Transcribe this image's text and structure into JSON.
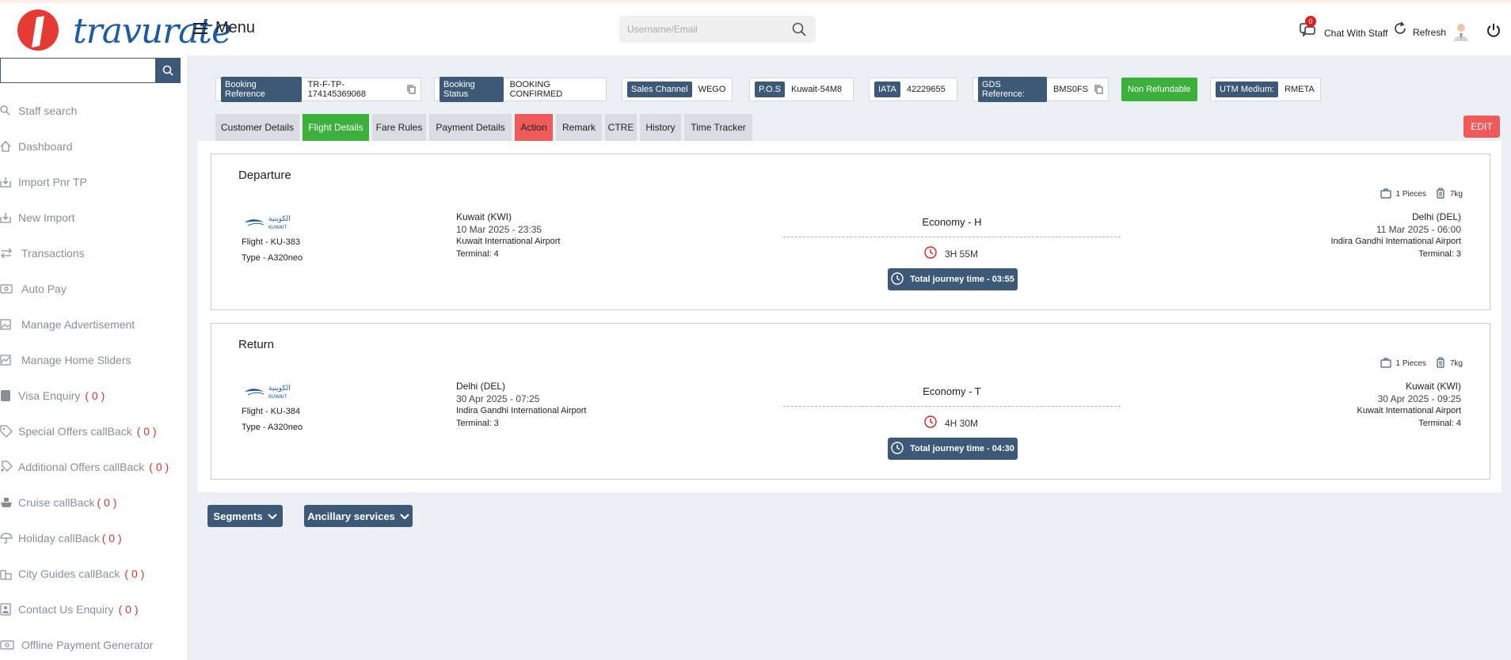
{
  "header": {
    "menu_label": "Menu",
    "search_placeholder": "Username/Email",
    "chat_badge": "0",
    "chat_label": "Chat With Staff",
    "refresh_label": "Refresh"
  },
  "sidebar": {
    "items": [
      {
        "label": "Staff search",
        "icon": "search-icon"
      },
      {
        "label": "Dashboard",
        "icon": "home-icon"
      },
      {
        "label": "Import Pnr TP",
        "icon": "import-icon"
      },
      {
        "label": "New Import",
        "icon": "import-icon"
      },
      {
        "label": "Transactions",
        "icon": "swap-icon"
      },
      {
        "label": "Auto Pay",
        "icon": "money-icon"
      },
      {
        "label": "Manage Advertisement",
        "icon": "image-icon"
      },
      {
        "label": "Manage Home Sliders",
        "icon": "chart-icon"
      },
      {
        "label": "Visa Enquiry",
        "icon": "passport-icon",
        "count": "( 0 )"
      },
      {
        "label": "Special Offers callBack",
        "icon": "tag-icon",
        "count": "( 0 )"
      },
      {
        "label": "Additional Offers callBack",
        "icon": "tag-plus-icon",
        "count": "( 0 )"
      },
      {
        "label": "Cruise callBack",
        "icon": "ship-icon",
        "count": "( 0 )"
      },
      {
        "label": "Holiday callBack",
        "icon": "umbrella-icon",
        "count": "( 0 )"
      },
      {
        "label": "City Guides callBack",
        "icon": "city-icon",
        "count": "( 0 )"
      },
      {
        "label": "Contact Us Enquiry",
        "icon": "contact-icon",
        "count": "( 0 )"
      },
      {
        "label": "Offline Payment Generator",
        "icon": "money-icon"
      }
    ]
  },
  "booking": {
    "reference_tag": "Booking Reference",
    "reference": "TR-F-TP-174145369068",
    "status_tag": "Booking Status",
    "status": "BOOKING CONFIRMED",
    "channel_tag": "Sales Channel",
    "channel": "WEGO",
    "pos_tag": "P.O.S",
    "pos": "Kuwait-54M8",
    "iata_tag": "IATA",
    "iata": "42229655",
    "gds_tag": "GDS Reference:",
    "gds": "BMS0FS",
    "refund": "Non Refundable",
    "utm_tag": "UTM Medium:",
    "utm": "RMETA"
  },
  "tabs": [
    "Customer Details",
    "Flight Details",
    "Fare Rules",
    "Payment Details",
    "Action",
    "Remark",
    "CTRE",
    "History",
    "Time Tracker"
  ],
  "edit_label": "EDIT",
  "legs": [
    {
      "title": "Departure",
      "pieces": "1 Pieces",
      "weight": "7kg",
      "flight": "Flight - KU-383",
      "type": "Type - A320neo",
      "from_city": "Kuwait (KWI)",
      "from_date": "10 Mar 2025 - 23:35",
      "from_airport": "Kuwait International Airport",
      "from_terminal": "Terminal: 4",
      "cabin": "Economy - H",
      "duration": "3H 55M",
      "journey": "Total journey time - 03:55",
      "to_city": "Delhi (DEL)",
      "to_date": "11 Mar 2025 - 06:00",
      "to_airport": "Indira Gandhi International Airport",
      "to_terminal": "Terminal: 3"
    },
    {
      "title": "Return",
      "pieces": "1 Pieces",
      "weight": "7kg",
      "flight": "Flight - KU-384",
      "type": "Type - A320neo",
      "from_city": "Delhi (DEL)",
      "from_date": "30 Apr 2025 - 07:25",
      "from_airport": "Indira Gandhi International Airport",
      "from_terminal": "Terminal: 3",
      "cabin": "Economy - T",
      "duration": "4H 30M",
      "journey": "Total journey time - 04:30",
      "to_city": "Kuwait (KWI)",
      "to_date": "30 Apr 2025 - 09:25",
      "to_airport": "Kuwait International Airport",
      "to_terminal": "Terminal: 4"
    }
  ],
  "bottom": {
    "segments": "Segments",
    "ancillary": "Ancillary services"
  },
  "colors": {
    "accent": "#3c5a78",
    "active_tab": "#3bb03b",
    "action_tab": "#ef5b5b",
    "logo_red": "#e63a35",
    "logo_blue": "#1d5a9e"
  }
}
